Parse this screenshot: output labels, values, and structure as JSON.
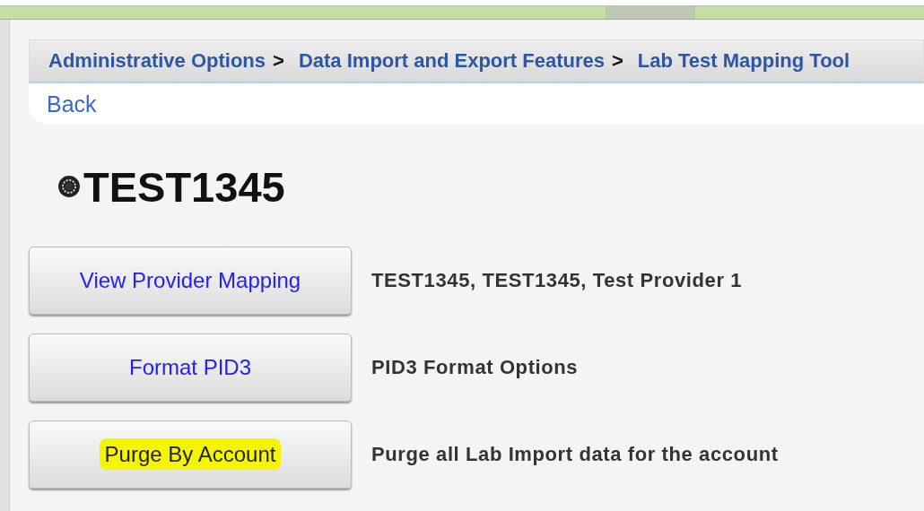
{
  "breadcrumbs": [
    {
      "label": "Administrative Options",
      "separator": ">"
    },
    {
      "label": "Data Import and Export Features",
      "separator": ">"
    },
    {
      "label": "Lab Test Mapping Tool"
    }
  ],
  "back_link": "Back",
  "title": "TEST1345",
  "actions": [
    {
      "label": "View Provider Mapping",
      "description": "TEST1345, TEST1345, Test Provider 1",
      "highlighted": false
    },
    {
      "label": "Format PID3",
      "description": "PID3 Format Options",
      "highlighted": false
    },
    {
      "label": "Purge By Account",
      "description": "Purge all Lab Import data for the account",
      "highlighted": true
    }
  ]
}
